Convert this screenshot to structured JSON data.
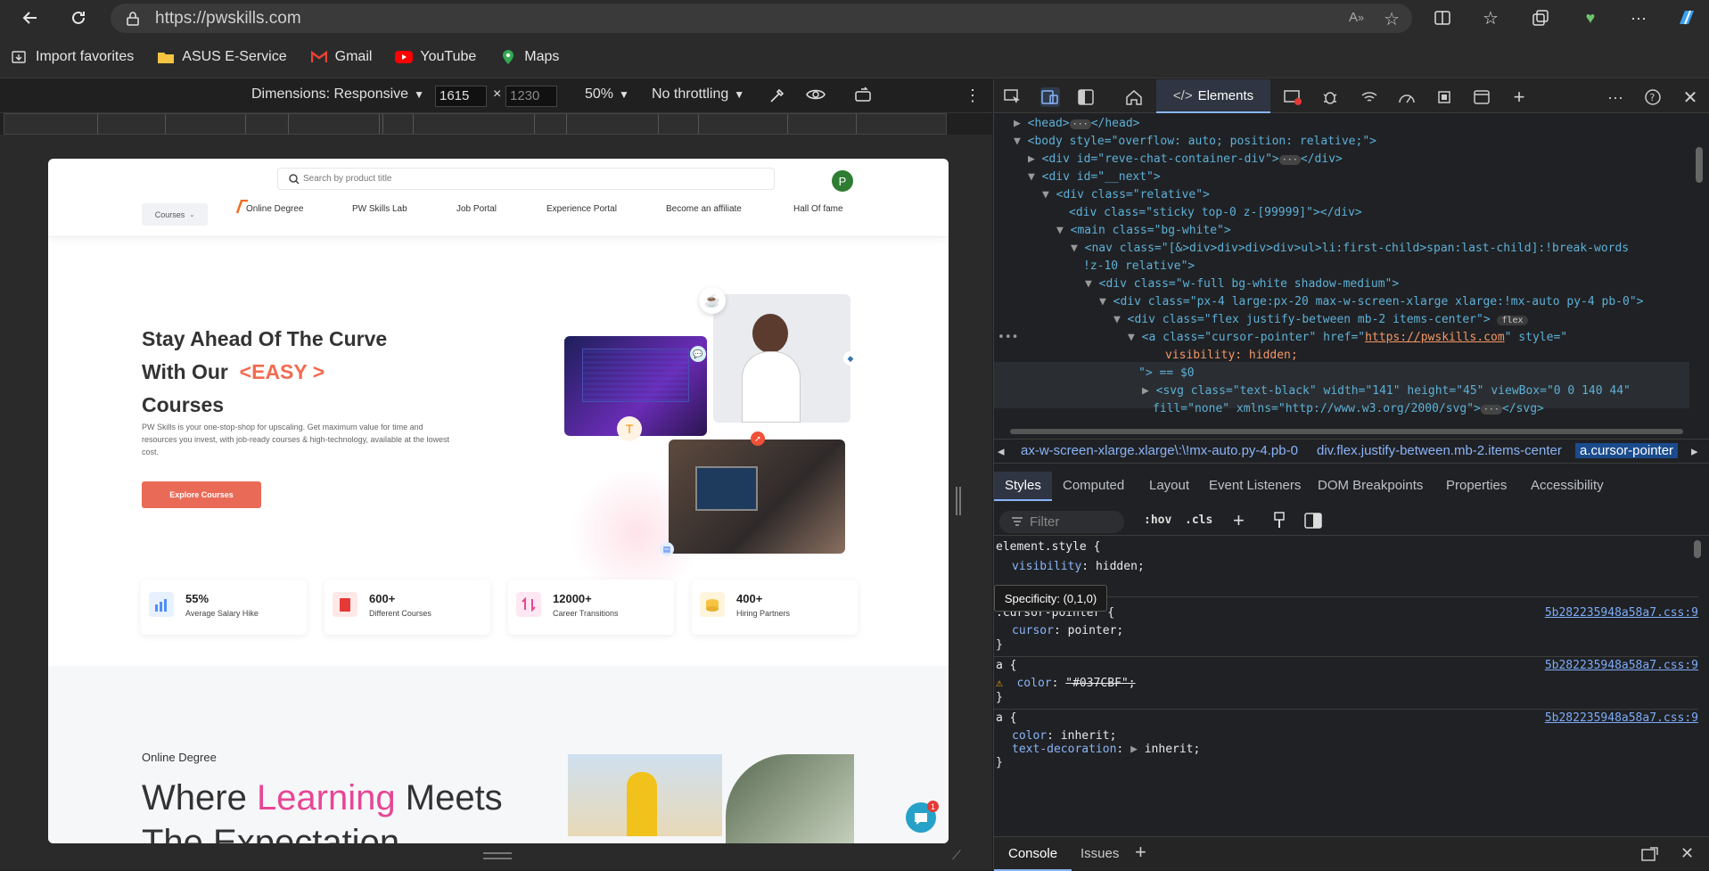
{
  "browser": {
    "url": "https://pwskills.com",
    "favorites": [
      {
        "label": "Import favorites",
        "icon": "import-icon"
      },
      {
        "label": "ASUS E-Service",
        "icon": "folder-icon"
      },
      {
        "label": "Gmail",
        "icon": "gmail-icon"
      },
      {
        "label": "YouTube",
        "icon": "youtube-icon"
      },
      {
        "label": "Maps",
        "icon": "maps-icon"
      }
    ]
  },
  "device_toolbar": {
    "dimensions_label": "Dimensions: Responsive",
    "width": "1615",
    "height": "1230",
    "times": "×",
    "zoom": "50%",
    "throttling": "No throttling"
  },
  "page": {
    "search_placeholder": "Search by product title",
    "avatar_letter": "P",
    "nav": {
      "courses": "Courses",
      "items": [
        "Online Degree",
        "PW Skills Lab",
        "Job Portal",
        "Experience Portal",
        "Become an affiliate",
        "Hall Of fame"
      ]
    },
    "hero": {
      "title_line1": "Stay Ahead Of The Curve",
      "title_line2_prefix": "With Our",
      "title_highlight": "<EASY >",
      "title_line3": "Courses",
      "description": "PW Skills is your one-stop-shop for upscaling. Get maximum value for time and resources you invest, with job-ready courses & high-technology, available at the lowest cost.",
      "cta": "Explore Courses"
    },
    "stats": [
      {
        "value": "55%",
        "label": "Average Salary Hike",
        "color": "#e8f1ff"
      },
      {
        "value": "600+",
        "label": "Different Courses",
        "color": "#ffe8e8"
      },
      {
        "value": "12000+",
        "label": "Career Transitions",
        "color": "#ffe8f2"
      },
      {
        "value": "400+",
        "label": "Hiring Partners",
        "color": "#fff5dc"
      }
    ],
    "section2": {
      "kicker": "Online Degree",
      "title_prefix": "Where",
      "title_highlight": "Learning",
      "title_suffix": "Meets",
      "title_line2": "The Expectation"
    },
    "chat_badge": "1"
  },
  "devtools": {
    "tab_elements": "Elements",
    "dom_lines": [
      "<head>",
      "</head>",
      "<body style=\"overflow: auto; position: relative;\">",
      "<div id=\"reve-chat-container-div\">",
      "</div>",
      "<div id=\"__next\">",
      "<div class=\"relative\">",
      "<div class=\"sticky top-0 z-[99999]\"></div>",
      "<main class=\"bg-white\">",
      "<nav class=\"[&>div>div>div>div>ul>li:first-child>span:last-child]:!break-words",
      "!z-10 relative\">",
      "<div class=\"w-full bg-white shadow-medium\">",
      "<div class=\"px-4 large:px-20 max-w-screen-xlarge xlarge:!mx-auto py-4 pb-0\">",
      "<div class=\"flex justify-between mb-2 items-center\">",
      "flex",
      "<a class=\"cursor-pointer\" href=\"",
      "https://pwskills.com",
      "\" style=\"",
      "visibility: hidden;",
      "\"> == $0",
      "<svg class=\"text-black\" width=\"141\" height=\"45\" viewBox=\"0 0 140 44\"",
      "fill=\"none\" xmlns=\"http://www.w3.org/2000/svg\">",
      "</svg>"
    ],
    "breadcrumbs": [
      "ax-w-screen-xlarge.xlarge\\:\\!mx-auto.py-4.pb-0",
      "div.flex.justify-between.mb-2.items-center",
      "a.cursor-pointer"
    ],
    "subtabs": [
      "Styles",
      "Computed",
      "Layout",
      "Event Listeners",
      "DOM Breakpoints",
      "Properties",
      "Accessibility"
    ],
    "filter_placeholder": "Filter",
    "hov": ":hov",
    "cls": ".cls",
    "rules": [
      {
        "selector": "element.style {",
        "prop": "visibility",
        "value": "hidden;",
        "source": ""
      },
      {
        "selector": ".cursor-pointer {",
        "prop": "cursor",
        "value": "pointer;",
        "source": "5b282235948a58a7.css:9"
      },
      {
        "selector": "a {",
        "prop": "color",
        "value": "\"#037CBF\";",
        "source": "5b282235948a58a7.css:9"
      },
      {
        "selector": "a {",
        "prop": "color",
        "value": "inherit;",
        "prop2": "text-decoration",
        "value2": "inherit;",
        "source": "5b282235948a58a7.css:9"
      }
    ],
    "tooltip": "Specificity: (0,1,0)",
    "closing_brace": "}",
    "drawer_tabs": [
      "Console",
      "Issues"
    ]
  }
}
